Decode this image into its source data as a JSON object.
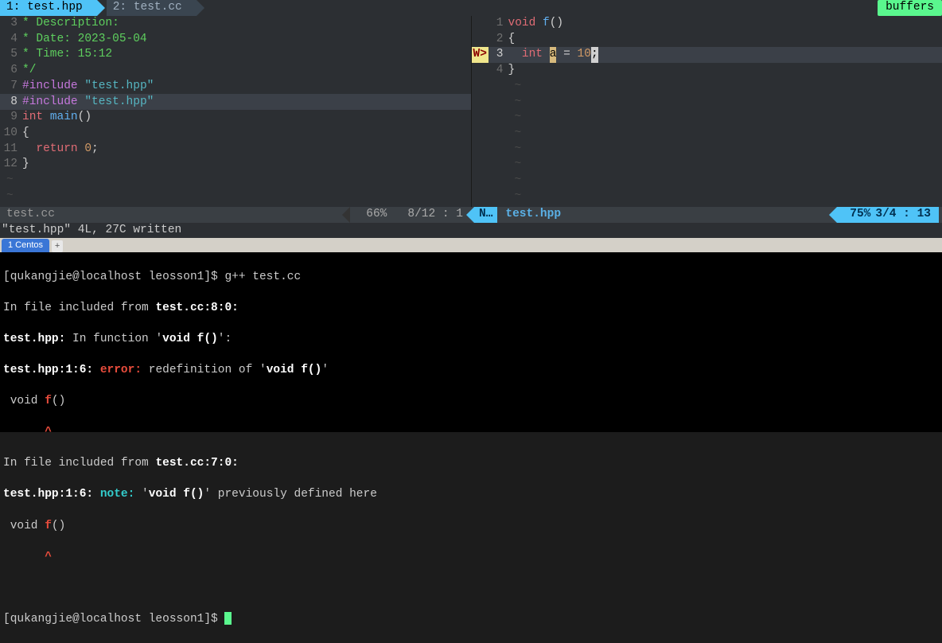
{
  "tabs": {
    "t1": "1: test.hpp",
    "t2": "2: test.cc",
    "buffers": "buffers"
  },
  "left": {
    "lines": [
      {
        "n": "3",
        "kind": "cmt",
        "text": "* Description:"
      },
      {
        "n": "4",
        "kind": "cmt",
        "text": "* Date: 2023-05-04"
      },
      {
        "n": "5",
        "kind": "cmt",
        "text": "* Time: 15:12"
      },
      {
        "n": "6",
        "kind": "cmt",
        "text": "*/"
      },
      {
        "n": "7",
        "kind": "inc",
        "pp": "#include ",
        "str": "\"test.hpp\""
      },
      {
        "n": "8",
        "kind": "inc",
        "pp": "#include ",
        "str": "\"test.hpp\"",
        "hl": true
      },
      {
        "n": "9",
        "kind": "main",
        "kw": "int ",
        "fn": "main",
        "rest": "()"
      },
      {
        "n": "10",
        "kind": "txt",
        "text": "{"
      },
      {
        "n": "11",
        "kind": "ret",
        "indent": "  ",
        "kw": "return ",
        "num": "0",
        "semi": ";"
      },
      {
        "n": "12",
        "kind": "txt",
        "text": "}"
      }
    ],
    "status_file": "test.cc",
    "pct": "66%",
    "pos": "8/12 :  1"
  },
  "right": {
    "warn": "W>",
    "lines": [
      {
        "n": "1",
        "kind": "fdecl",
        "kw": "void ",
        "fn": "f",
        "rest": "()"
      },
      {
        "n": "2",
        "kind": "txt",
        "text": "{"
      },
      {
        "n": "3",
        "kind": "var",
        "indent": "  ",
        "kw": "int ",
        "var": "a",
        "eq": " = ",
        "num": "10",
        "semi": ";",
        "hl": true
      },
      {
        "n": "4",
        "kind": "txt",
        "text": "}"
      }
    ],
    "mode": "N…",
    "status_file": "test.hpp",
    "pct": "75%",
    "pos": "3/4 :  13"
  },
  "msg": "\"test.hpp\" 4L, 27C written",
  "term": {
    "tab": "1 Centos",
    "prompt1": "[qukangjie@localhost leosson1]$ ",
    "cmd1": "g++ test.cc",
    "l1a": "In file included from ",
    "l1b": "test.cc:8:0:",
    "l2a": "test.hpp:",
    "l2b": " In function '",
    "l2c": "void f()",
    "l2d": "':",
    "l3a": "test.hpp:1:6: ",
    "l3err": "error: ",
    "l3b": "redefinition of '",
    "l3c": "void f()",
    "l3d": "'",
    "l4a": " void ",
    "l4b": "f",
    "l4c": "()",
    "l5": "      ^",
    "l6a": "In file included from ",
    "l6b": "test.cc:7:0:",
    "l7a": "test.hpp:1:6: ",
    "l7note": "note: ",
    "l7b": "'",
    "l7c": "void f()",
    "l7d": "' previously defined here",
    "l8a": " void ",
    "l8b": "f",
    "l8c": "()",
    "l9": "      ^",
    "prompt2": "[qukangjie@localhost leosson1]$ "
  }
}
